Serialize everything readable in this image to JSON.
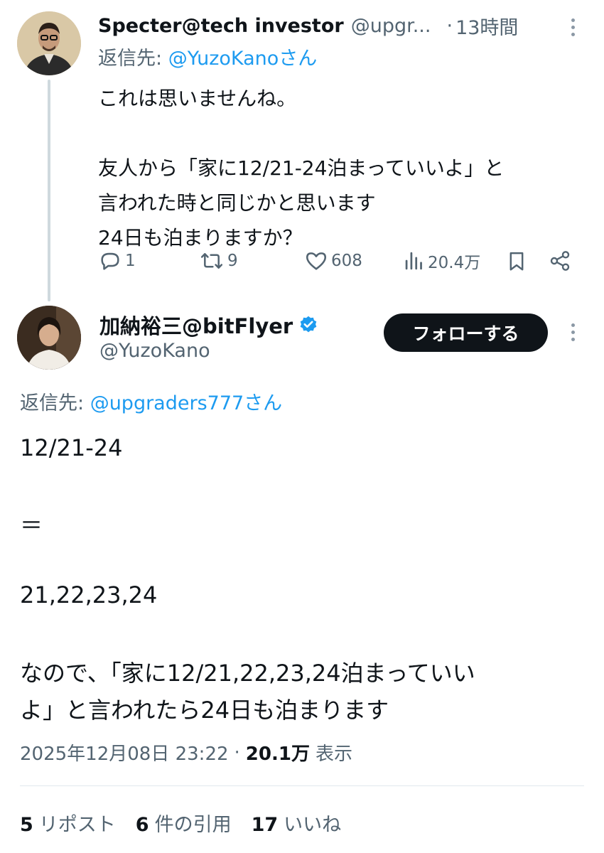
{
  "tweet1": {
    "display_name": "Specter@tech investor",
    "handle": "@upgr...",
    "separator": "·",
    "time": "13時間",
    "reply_prefix": "返信先: ",
    "reply_handle": "@YuzoKanoさん",
    "lines": [
      "これは思いませんね。",
      "",
      "友人から「家に12/21-24泊まっていいよ」と",
      "言われた時と同じかと思います",
      "24日も泊まりますか？"
    ],
    "actions": {
      "replies": "1",
      "reposts": "9",
      "likes": "608",
      "views": "20.4万"
    },
    "icons": [
      "reply-icon",
      "repost-icon",
      "like-icon",
      "views-icon",
      "bookmark-icon",
      "share-icon",
      "more-icon"
    ]
  },
  "tweet2": {
    "display_name": "加納裕三@bitFlyer",
    "handle": "@YuzoKano",
    "follow_label": "フォローする",
    "verified_color": "#1d9bf0",
    "reply_prefix": "返信先: ",
    "reply_handle": "@upgraders777さん",
    "body": {
      "l1": "12/21-24",
      "l2": "＝",
      "l3": "21,22,23,24",
      "l4": "なので、「家に12/21,22,23,24泊まっていい",
      "l5": "よ」と言われたら24日も泊まります"
    },
    "timestamp": "2025年12月08日 23:22",
    "dot": "·",
    "view_count": "20.1万",
    "view_label": "表示",
    "stats": [
      {
        "count": "5",
        "label": "リポスト"
      },
      {
        "count": "6",
        "label": "件の引用"
      },
      {
        "count": "17",
        "label": "いいね"
      }
    ]
  },
  "colors": {
    "text": "#0f1419",
    "muted": "#536471",
    "link": "#1d9bf0",
    "button": "#0f1419"
  }
}
